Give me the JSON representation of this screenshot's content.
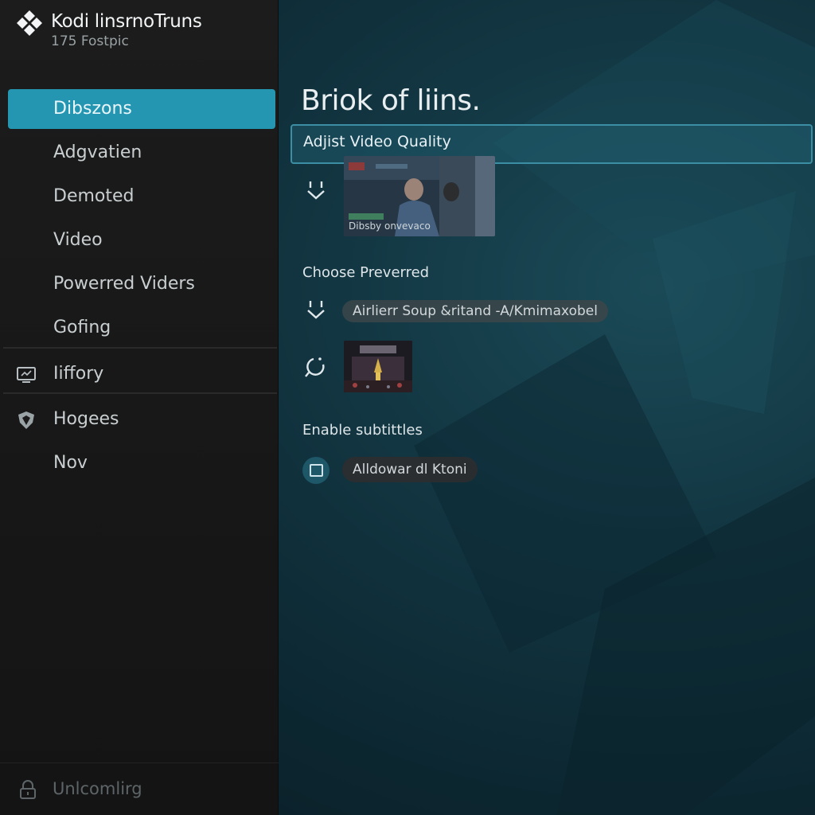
{
  "app": {
    "title": "Kodi linsrnoTruns",
    "subtitle": "175 Fostpic"
  },
  "sidebar": {
    "items": [
      {
        "label": "Dibszons",
        "active": true
      },
      {
        "label": "Adgvatien"
      },
      {
        "label": "Demoted"
      },
      {
        "label": "Video"
      },
      {
        "label": "Powerred Viders"
      },
      {
        "label": "Gofing"
      },
      {
        "label": "Iiffory",
        "icon": "monitor-icon"
      },
      {
        "label": "Hogees",
        "icon": "shield-icon"
      },
      {
        "label": "Nov"
      }
    ],
    "footer": {
      "label": "Unlcomlirg",
      "icon": "lock-icon"
    }
  },
  "main": {
    "title": "Briok of liins.",
    "quality_label": "Adjist Video Quality",
    "preview_caption": "Dibsby onvevaco",
    "preferred_title": "Choose Preverred",
    "audio_pill": "Airlierr Soup &ritand -A/Kmimaxobel",
    "subtitles_title": "Enable subtittles",
    "subtitle_pill": "Alldowar dl Ktoni"
  },
  "colors": {
    "accent": "#2496b2",
    "sidebar_bg": "#1a1a1a",
    "main_bg": "#123642"
  }
}
